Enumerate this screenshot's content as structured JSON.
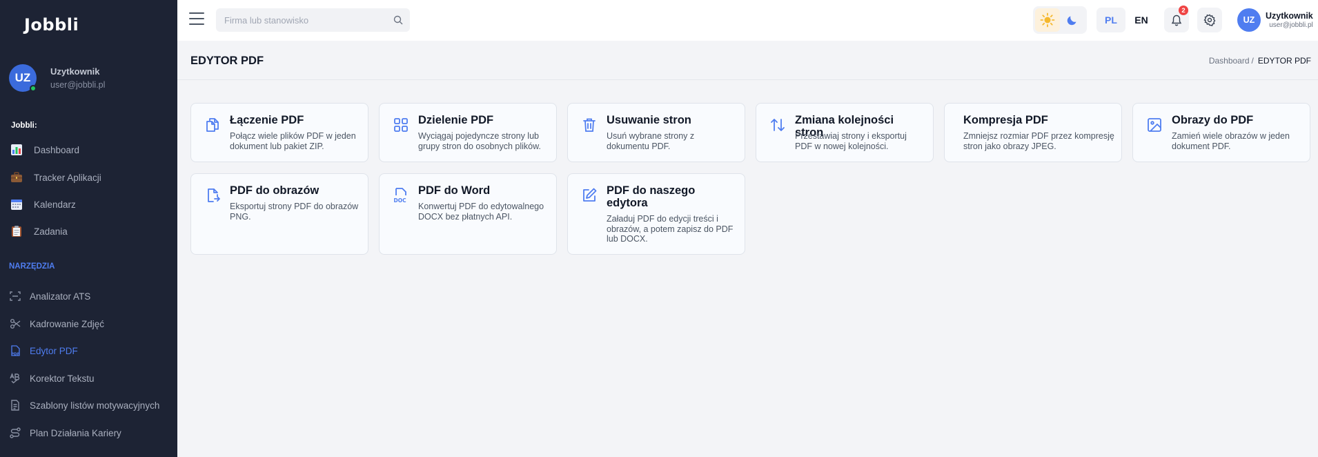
{
  "app": {
    "logo": "Jobbli"
  },
  "sidebar": {
    "profile": {
      "initials": "UZ",
      "name": "Uzytkownik",
      "email": "user@jobbli.pl"
    },
    "section_jobbli": "Jobbli",
    "main_items": [
      {
        "label": "Dashboard",
        "icon": "bar-chart-icon"
      },
      {
        "label": "Tracker Aplikacji",
        "icon": "briefcase-icon"
      },
      {
        "label": "Kalendarz",
        "icon": "calendar-icon"
      },
      {
        "label": "Zadania",
        "icon": "clipboard-icon"
      }
    ],
    "section_tools": "NARZĘDZIA",
    "tool_items": [
      {
        "label": "Analizator ATS",
        "icon": "scan-icon"
      },
      {
        "label": "Kadrowanie Zdjęć",
        "icon": "scissors-icon"
      },
      {
        "label": "Edytor PDF",
        "icon": "pdf-file-icon",
        "active": true
      },
      {
        "label": "Korektor Tekstu",
        "icon": "spellcheck-icon"
      },
      {
        "label": "Szablony listów motywacyjnych",
        "icon": "document-icon"
      },
      {
        "label": "Plan Działania Kariery",
        "icon": "route-icon"
      }
    ]
  },
  "topbar": {
    "search_placeholder": "Firma lub stanowisko",
    "languages": [
      "PL",
      "EN"
    ],
    "active_language": "PL",
    "theme": "light",
    "notification_count": "2",
    "user": {
      "initials": "UZ",
      "name": "Uzytkownik",
      "email": "user@jobbli.pl"
    }
  },
  "page": {
    "title": "EDYTOR PDF",
    "breadcrumb": {
      "parent": "Dashboard",
      "separator": "/",
      "current": "EDYTOR PDF"
    }
  },
  "tools": [
    {
      "title": "Łączenie PDF",
      "description": "Połącz wiele plików PDF w jeden dokument lub pakiet ZIP.",
      "icon": "merge-files-icon"
    },
    {
      "title": "Dzielenie PDF",
      "description": "Wyciągaj pojedyncze strony lub grupy stron do osobnych plików.",
      "icon": "grid-split-icon"
    },
    {
      "title": "Usuwanie stron",
      "description": "Usuń wybrane strony z dokumentu PDF.",
      "icon": "trash-icon"
    },
    {
      "title": "Zmiana kolejności stron",
      "description": "Przestawiaj strony i eksportuj PDF w nowej kolejności.",
      "icon": "reorder-arrows-icon"
    },
    {
      "title": "Kompresja PDF",
      "description": "Zmniejsz rozmiar PDF przez kompresję stron jako obrazy JPEG.",
      "icon": ""
    },
    {
      "title": "Obrazy do PDF",
      "description": "Zamień wiele obrazów w jeden dokument PDF.",
      "icon": "image-icon"
    },
    {
      "title": "PDF do obrazów",
      "description": "Eksportuj strony PDF do obrazów PNG.",
      "icon": "file-export-icon"
    },
    {
      "title": "PDF do Word",
      "description": "Konwertuj PDF do edytowalnego DOCX bez płatnych API.",
      "icon": "doc-file-icon"
    },
    {
      "title": "PDF do naszego edytora",
      "description": "Załaduj PDF do edycji treści i obrazów, a potem zapisz do PDF lub DOCX.",
      "icon": "edit-icon"
    }
  ],
  "colors": {
    "accent": "#4f7df0",
    "sidebar_bg": "#1d2334",
    "badge": "#ef4444"
  }
}
